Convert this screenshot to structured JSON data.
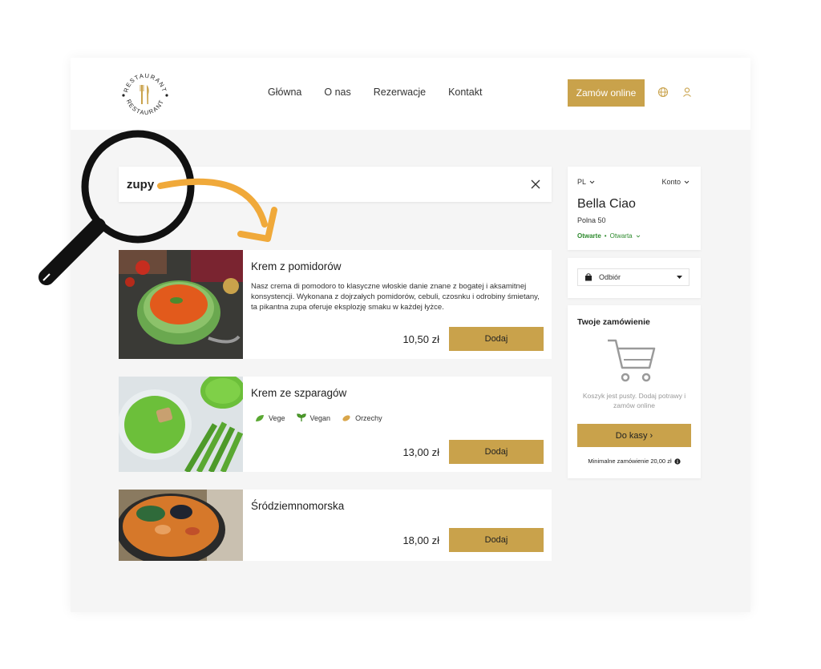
{
  "header": {
    "logo_text": "RESTAURANT",
    "nav": [
      "Główna",
      "O nas",
      "Rezerwacje",
      "Kontakt"
    ],
    "order_online_label": "Zamów online",
    "language_icon": "globe-icon",
    "account_icon": "user-icon"
  },
  "search": {
    "value": "zupy"
  },
  "dishes": [
    {
      "name": "Krem z pomidorów",
      "description": "Nasz crema di pomodoro to klasyczne włoskie danie znane z bogatej i aksamitnej konsystencji. Wykonana z dojrzałych pomidorów, cebuli, czosnku i odrobiny śmietany, ta pikantna zupa oferuje eksplozję smaku w każdej łyżce.",
      "price": "10,50 zł",
      "add_label": "Dodaj"
    },
    {
      "name": "Krem ze szparagów",
      "tags": [
        "Vege",
        "Vegan",
        "Orzechy"
      ],
      "price": "13,00 zł",
      "add_label": "Dodaj"
    },
    {
      "name": "Śródziemnomorska",
      "price": "18,00 zł",
      "add_label": "Dodaj"
    }
  ],
  "restaurant": {
    "language": "PL",
    "account_label": "Konto",
    "name": "Bella Ciao",
    "address": "Polna 50",
    "status": "Otwarte",
    "status_detail": "Otwarta"
  },
  "delivery": {
    "mode": "Odbiór"
  },
  "order": {
    "title": "Twoje zamówienie",
    "empty_message": "Koszyk jest pusty. Dodaj potrawy i zamów online",
    "checkout_label": "Do kasy ›",
    "minimum_text": "Minimalne zamówienie 20,00 zł"
  },
  "colors": {
    "accent": "#c9a24b",
    "open_status": "#2e8b2e"
  }
}
